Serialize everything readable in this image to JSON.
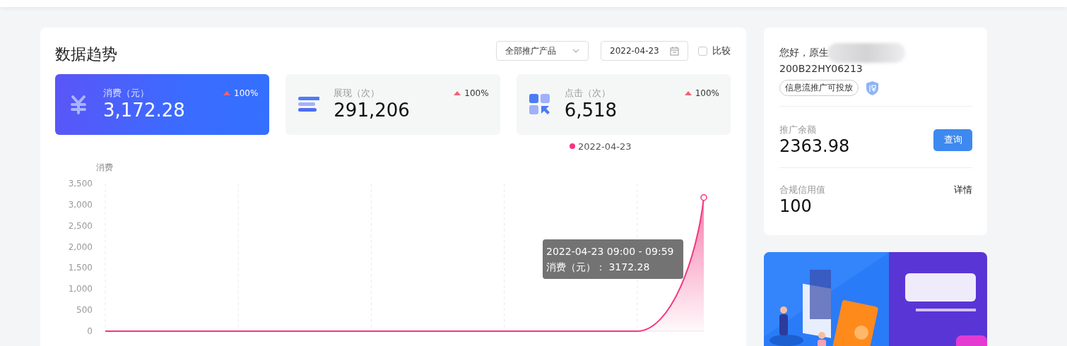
{
  "trend": {
    "title": "数据趋势",
    "product_select": {
      "value": "全部推广产品"
    },
    "date_picker": {
      "value": "2022-04-23"
    },
    "compare": {
      "label": "比较",
      "checked": false
    },
    "metrics": [
      {
        "kind": "cost",
        "label": "消费（元）",
        "value": "3,172.28",
        "change": "100%",
        "selected": true
      },
      {
        "kind": "impressions",
        "label": "展现（次）",
        "value": "291,206",
        "change": "100%",
        "selected": false
      },
      {
        "kind": "clicks",
        "label": "点击（次）",
        "value": "6,518",
        "change": "100%",
        "selected": false
      }
    ],
    "chart_data": {
      "type": "line",
      "ylabel": "消费",
      "ylim": [
        0,
        3500
      ],
      "yticks": [
        0,
        500,
        {
          "value": 1000,
          "label": "1,000"
        },
        {
          "value": 1500,
          "label": "1,500"
        },
        {
          "value": 2000,
          "label": "2,000"
        },
        {
          "value": 2500,
          "label": "2,500"
        },
        {
          "value": 3000,
          "label": "3,000"
        },
        {
          "value": 3500,
          "label": "3,500"
        }
      ],
      "grid": true,
      "series": [
        {
          "name": "2022-04-23",
          "color": "#f5367f",
          "values": [
            0,
            0,
            0,
            0,
            0,
            0,
            0,
            0,
            0,
            3170
          ]
        }
      ]
    },
    "tooltip": {
      "title": "2022-04-23 09:00 - 09:59",
      "line": "消费（元）： 3172.28"
    }
  },
  "account": {
    "greeting": "您好，原生",
    "id": "200B22HY06213",
    "tag": "信息流推广可投放",
    "balance": {
      "label": "推广余额",
      "value": "2363.98",
      "button": "查询"
    },
    "credit": {
      "label": "合规信用值",
      "value": "100",
      "link": "详情"
    }
  }
}
